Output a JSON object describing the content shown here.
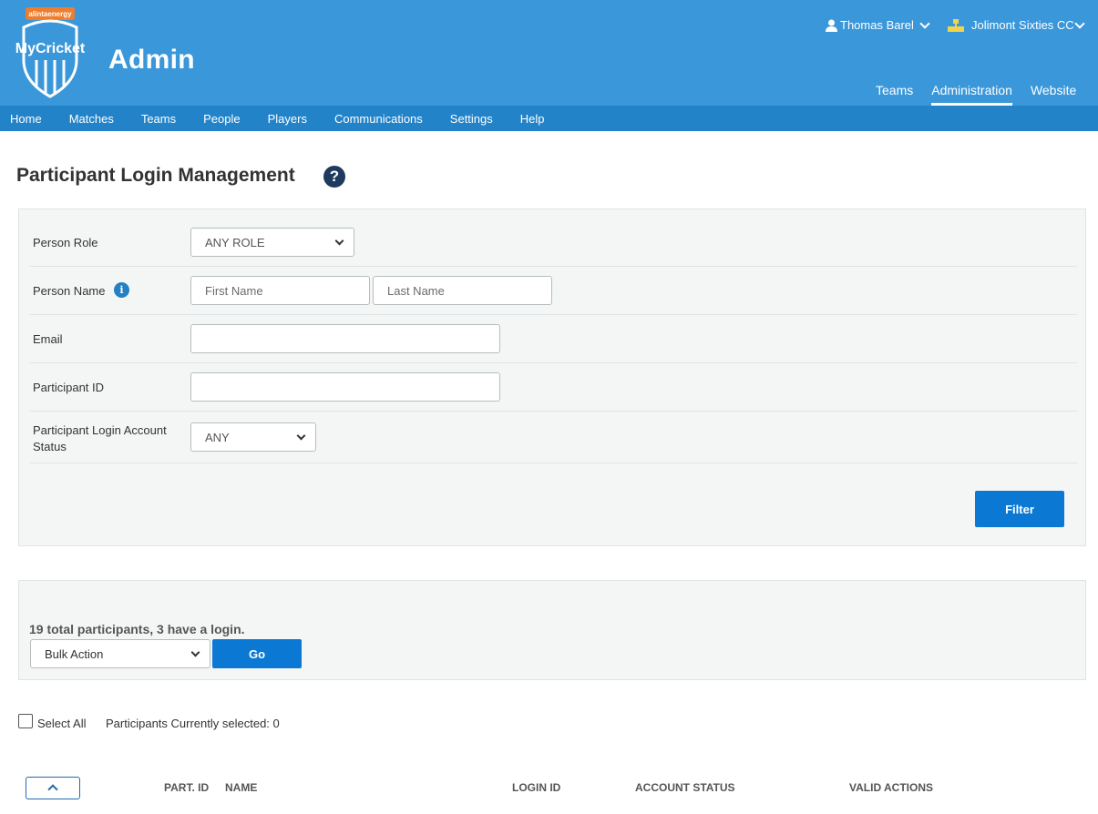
{
  "header": {
    "sponsor": "alintaenergy",
    "brand": "MyCricket",
    "app_title": "Admin",
    "user_name": "Thomas Barel",
    "club_name": "Jolimont Sixties CC",
    "tabs": [
      {
        "label": "Teams",
        "active": false
      },
      {
        "label": "Administration",
        "active": true
      },
      {
        "label": "Website",
        "active": false
      }
    ]
  },
  "nav": {
    "items": [
      "Home",
      "Matches",
      "Teams",
      "People",
      "Players",
      "Communications",
      "Settings",
      "Help"
    ]
  },
  "page": {
    "title": "Participant Login Management"
  },
  "filter": {
    "person_role_label": "Person Role",
    "person_role_value": "ANY ROLE",
    "person_name_label": "Person Name",
    "first_name_placeholder": "First Name",
    "last_name_placeholder": "Last Name",
    "email_label": "Email",
    "email_value": "",
    "participant_id_label": "Participant ID",
    "participant_id_value": "",
    "status_label_line1": "Participant Login Account",
    "status_label_line2": "Status",
    "status_value": "ANY",
    "filter_button": "Filter"
  },
  "results": {
    "summary": "19 total participants, 3 have a login.",
    "bulk_action": "Bulk Action",
    "go_button": "Go",
    "select_all_label": "Select All",
    "selected_count": "Participants Currently selected: 0"
  },
  "table": {
    "columns": [
      "PART. ID",
      "NAME",
      "LOGIN ID",
      "ACCOUNT STATUS",
      "VALID ACTIONS"
    ]
  },
  "colors": {
    "header_bg": "#3a97d9",
    "nav_bg": "#2283c8",
    "primary_button": "#0b79d4",
    "panel_bg": "#f4f6f6"
  }
}
